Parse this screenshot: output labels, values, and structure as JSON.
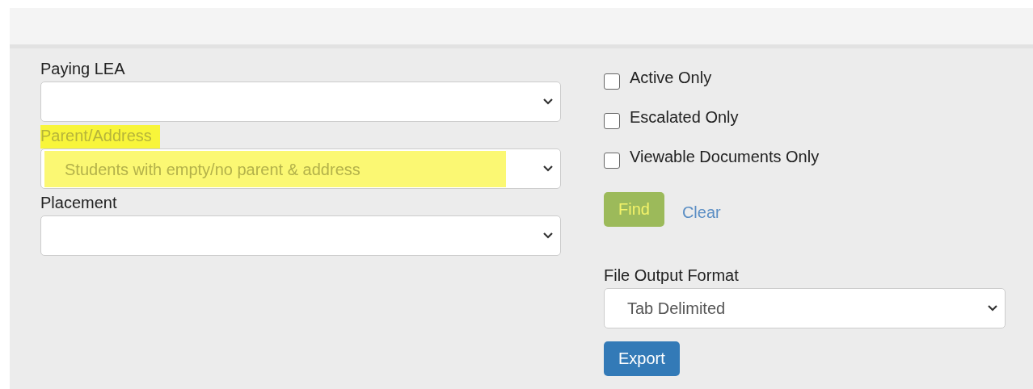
{
  "filters": [
    {
      "label": "Paying LEA",
      "highlighted": false
    },
    {
      "label": "Parent/Address",
      "value": "Students with empty/no parent & address",
      "highlighted": true
    },
    {
      "label": "Placement",
      "highlighted": false
    }
  ],
  "checkboxes": [
    {
      "label": "Active Only",
      "checked": false
    },
    {
      "label": "Escalated Only",
      "checked": false
    },
    {
      "label": "Viewable Documents Only",
      "checked": false
    }
  ],
  "find_button": {
    "label": "Find",
    "highlighted": true
  },
  "clear_link": {
    "label": "Clear"
  },
  "output_format": {
    "label": "File Output Format",
    "value": "Tab Delimited"
  },
  "export_button": {
    "label": "Export"
  }
}
